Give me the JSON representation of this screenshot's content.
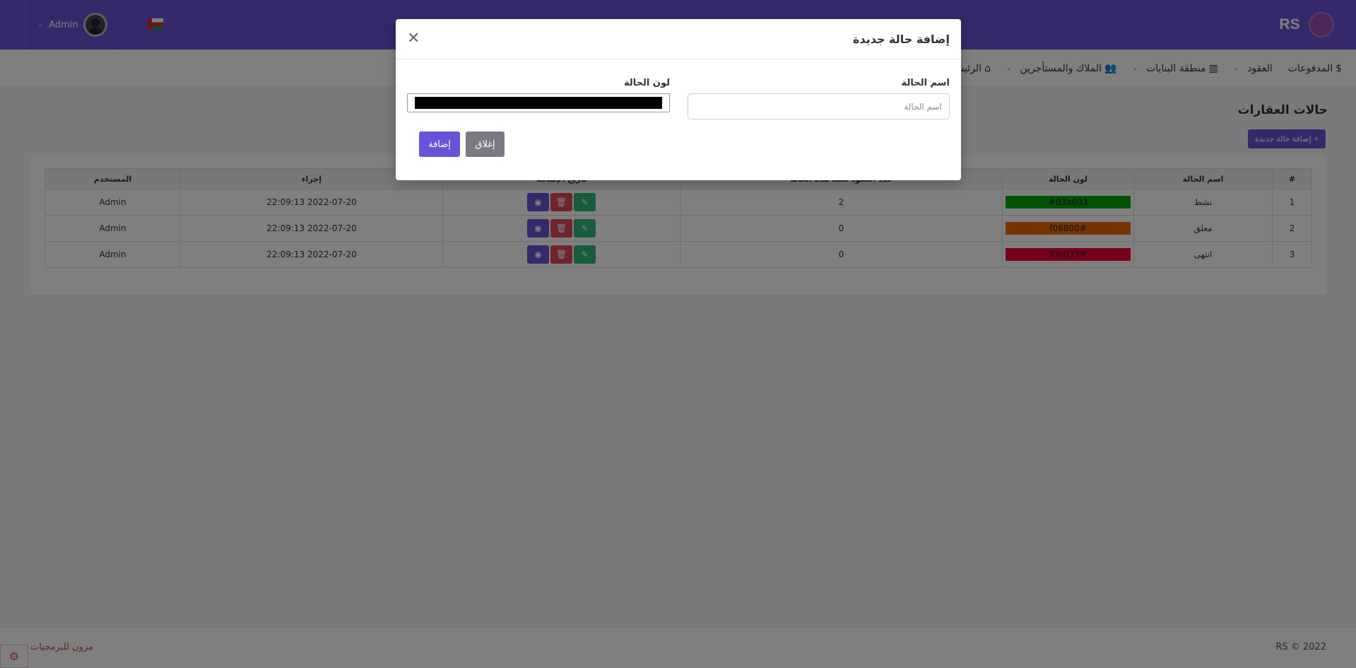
{
  "topbar": {
    "logo": "RS",
    "user_name": "Admin"
  },
  "nav": {
    "items": [
      {
        "label": "الرئيسية",
        "icon": "home-icon",
        "glyph": "⌂",
        "dropdown": false
      },
      {
        "label": "الملاك والمستأجرين",
        "icon": "users-icon",
        "glyph": "👥",
        "dropdown": true
      },
      {
        "label": "منطقة البنايات",
        "icon": "building-icon",
        "glyph": "▥",
        "dropdown": true
      },
      {
        "label": "العقود",
        "icon": "",
        "glyph": "",
        "dropdown": true
      },
      {
        "label": "المدفوعات",
        "icon": "dollar-icon",
        "glyph": "$",
        "dropdown": false
      }
    ]
  },
  "page": {
    "title": "حالات العقارات",
    "add_button": "إضافة حالة جديدة"
  },
  "table": {
    "headers": [
      "#",
      "اسم الحالة",
      "لون الحالة",
      "عدد العقود تحت هذه الحالة",
      "تاريخ الإضافة",
      "إجراء",
      "المستخدم"
    ],
    "rows": [
      {
        "num": "1",
        "name": "نشط",
        "color": "#03a603",
        "color_label": "#03a603",
        "count": "2",
        "date": "2022-07-20 22:09:13",
        "user": "Admin"
      },
      {
        "num": "2",
        "name": "معلق",
        "color": "#f06800",
        "color_label": "#f06800",
        "count": "0",
        "date": "2022-07-20 22:09:13",
        "user": "Admin"
      },
      {
        "num": "3",
        "name": "انتهى",
        "color": "#f00033",
        "color_label": "#f00033",
        "count": "0",
        "date": "2022-07-20 22:09:13",
        "user": "Admin"
      }
    ]
  },
  "footer": {
    "copyright": "RS © 2022",
    "company": "مزون للبرمجيات"
  },
  "modal": {
    "title": "إضافة حالة جديدة",
    "name_label": "اسم الحالة",
    "name_placeholder": "اسم الحالة",
    "color_label": "لون الحالة",
    "color_value": "#000000",
    "close_button": "إغلاق",
    "submit_button": "إضافة"
  },
  "colors": {
    "accent": "#6a52d8",
    "danger": "#e04b5a",
    "success": "#2eb87a"
  }
}
